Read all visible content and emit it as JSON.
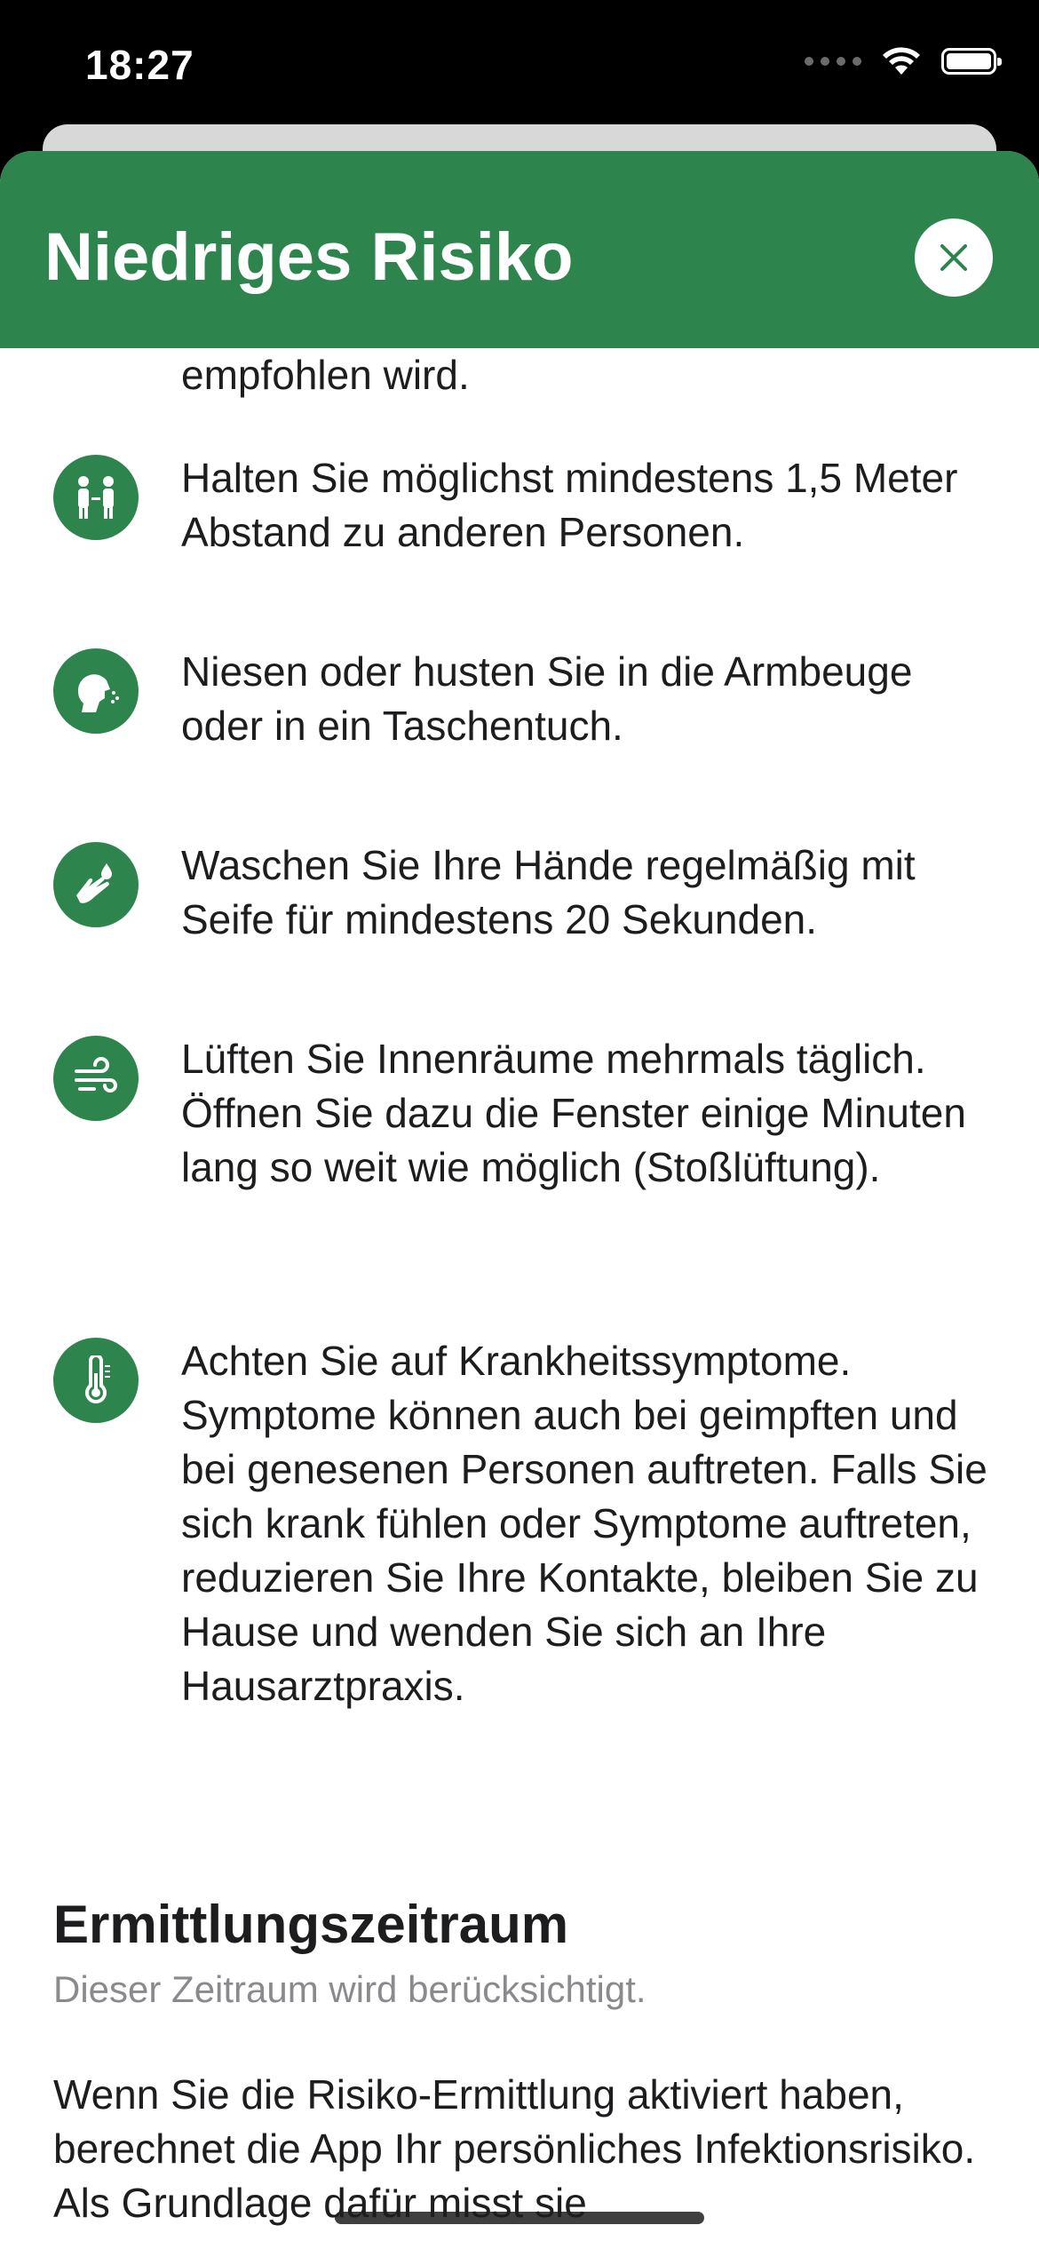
{
  "status": {
    "time": "18:27"
  },
  "sheet": {
    "title": "Niedriges Risiko",
    "header_color": "#2e844d"
  },
  "partial_text": "empfohlen wird.",
  "tips": [
    {
      "icon": "distance-people-icon",
      "text": "Halten Sie möglichst mindestens 1,5 Meter Abstand zu anderen Personen."
    },
    {
      "icon": "sneeze-icon",
      "text": "Niesen oder husten Sie in die Armbeuge oder in ein Taschentuch."
    },
    {
      "icon": "hand-wash-icon",
      "text": "Waschen Sie Ihre Hände regelmäßig mit Seife für mindestens 20 Sekunden."
    },
    {
      "icon": "ventilation-icon",
      "text": "Lüften Sie Innenräume mehrmals täglich. Öffnen Sie dazu die Fenster einige Minuten lang so weit wie möglich (Stoßlüftung)."
    },
    {
      "icon": "thermometer-icon",
      "text": "Achten Sie auf Krankheitssymptome. Symptome können auch bei geimpften und bei genesenen Personen auftreten. Falls Sie sich krank fühlen oder Symptome auftreten, reduzieren Sie Ihre Kontakte, bleiben Sie zu Hause und wenden Sie sich an Ihre Hausarztpraxis."
    }
  ],
  "section": {
    "title": "Ermittlungszeitraum",
    "subtitle": "Dieser Zeitraum wird berücksichtigt.",
    "body": "Wenn Sie die Risiko-Ermittlung aktiviert haben, berechnet die App Ihr persönliches Infektionsrisiko. Als Grundlage dafür misst sie"
  }
}
